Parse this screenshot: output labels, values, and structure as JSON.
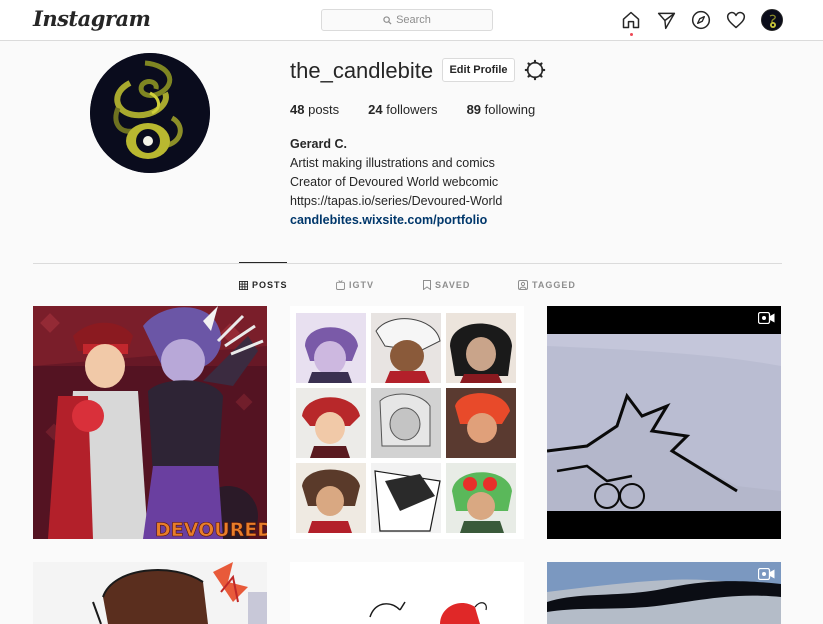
{
  "app": {
    "logo": "Instagram",
    "search_placeholder": "Search"
  },
  "nav": {
    "icons": [
      "home-icon",
      "send-icon",
      "explore-icon",
      "heart-icon",
      "profile-avatar-icon"
    ]
  },
  "profile": {
    "username": "the_candlebite",
    "edit_button": "Edit Profile",
    "stats": {
      "posts_count": "48",
      "posts_label": "posts",
      "followers_count": "24",
      "followers_label": "followers",
      "following_count": "89",
      "following_label": "following"
    },
    "bio": {
      "name": "Gerard C.",
      "line1": "Artist making illustrations and comics",
      "line2": "Creator of Devoured World webcomic",
      "line3": "https://tapas.io/series/Devoured-World",
      "link": "candlebites.wixsite.com/portfolio"
    }
  },
  "tabs": [
    {
      "label": "POSTS",
      "icon": "grid-icon",
      "active": true
    },
    {
      "label": "IGTV",
      "icon": "igtv-icon",
      "active": false
    },
    {
      "label": "SAVED",
      "icon": "bookmark-icon",
      "active": false
    },
    {
      "label": "TAGGED",
      "icon": "tagged-icon",
      "active": false
    }
  ],
  "posts": {
    "p1_caption_art": "DEVOURED",
    "video_posts": [
      "post-3",
      "post-6"
    ]
  },
  "colors": {
    "accent_link": "#00376b",
    "notification_dot": "#ed4956",
    "border": "#dbdbdb"
  }
}
